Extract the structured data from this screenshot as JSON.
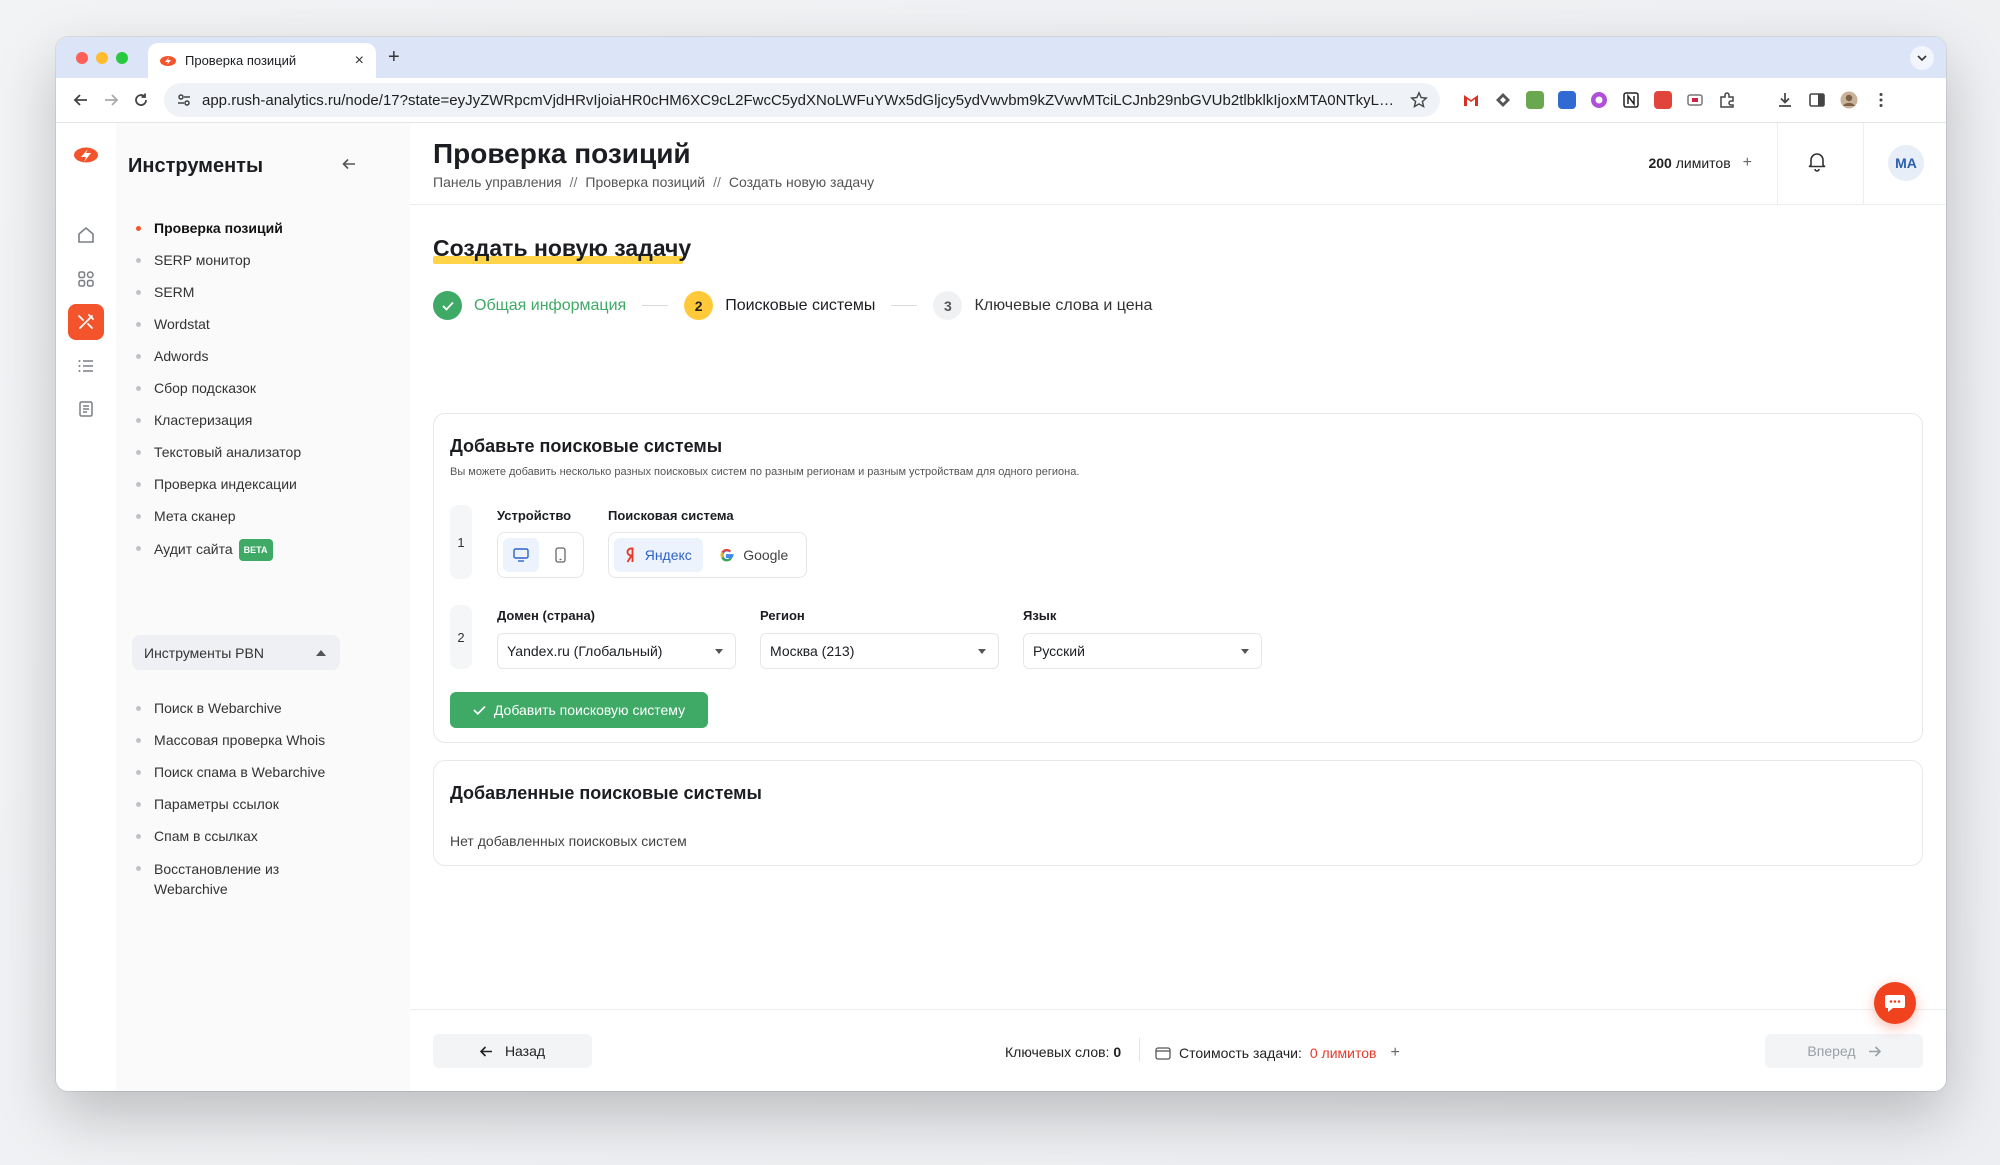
{
  "browser": {
    "tab_title": "Проверка позиций",
    "new_tab": "+",
    "tab_close": "×",
    "url": "app.rush-analytics.ru/node/17?state=eyJyZWRpcmVjdHRvIjoiaHR0cHM6XC9cL2FwcC5ydXNoLWFuYWx5dGljcy5ydVwvbm9kZVwvMTciLCJnb29nbGVUb2tlbklkIjoxMTA0NTkyLCJ5Y...",
    "icons": [
      "back-arrow-icon",
      "forward-arrow-icon",
      "reload-icon",
      "site-settings-icon",
      "star-icon"
    ]
  },
  "sidebar": {
    "title": "Инструменты",
    "tools": [
      {
        "label": "Проверка позиций",
        "active": true
      },
      {
        "label": "SERP монитор"
      },
      {
        "label": "SERM"
      },
      {
        "label": "Wordstat"
      },
      {
        "label": "Adwords"
      },
      {
        "label": "Сбор подсказок"
      },
      {
        "label": "Кластеризация"
      },
      {
        "label": "Текстовый анализатор"
      },
      {
        "label": "Проверка индексации"
      },
      {
        "label": "Мета сканер"
      },
      {
        "label": "Аудит сайта",
        "badge": "BETA"
      }
    ],
    "pbn_toggle": "Инструменты PBN",
    "pbn_tools": [
      {
        "label": "Поиск в Webarchive"
      },
      {
        "label": "Массовая проверка Whois"
      },
      {
        "label": "Поиск спама в Webarchive"
      },
      {
        "label": "Параметры ссылок"
      },
      {
        "label": "Спам в ссылках"
      },
      {
        "label": "Восстановление из Webarchive"
      }
    ]
  },
  "header": {
    "title": "Проверка позиций",
    "breadcrumb": [
      "Панель управления",
      "Проверка позиций",
      "Создать новую задачу"
    ],
    "breadcrumb_sep": "//",
    "limits_value": "200",
    "limits_label": "лимитов",
    "limits_plus": "+",
    "avatar": "MA"
  },
  "page": {
    "section_title": "Создать новую задачу",
    "steps": [
      {
        "num": "",
        "label": "Общая информация",
        "state": "done"
      },
      {
        "num": "2",
        "label": "Поисковые системы",
        "state": "current"
      },
      {
        "num": "3",
        "label": "Ключевые слова и цена",
        "state": "next"
      }
    ]
  },
  "add_card": {
    "title": "Добавьте поисковые системы",
    "subtitle": "Вы можете добавить несколько разных поисковых систем по разным регионам и разным устройствам для одного региона.",
    "row1_num": "1",
    "row2_num": "2",
    "device_label": "Устройство",
    "engine_label": "Поисковая система",
    "engines": [
      {
        "label": "Яндекс",
        "selected": true
      },
      {
        "label": "Google",
        "selected": false
      }
    ],
    "domain_label": "Домен (страна)",
    "domain_value": "Yandex.ru (Глобальный)",
    "region_label": "Регион",
    "region_value": "Москва (213)",
    "language_label": "Язык",
    "language_value": "Русский",
    "add_button": "Добавить поисковую систему"
  },
  "added_card": {
    "title": "Добавленные поисковые системы",
    "empty_text": "Нет добавленных поисковых систем"
  },
  "footer": {
    "back": "Назад",
    "keywords_label": "Ключевых слов:",
    "keywords_value": "0",
    "cost_label": "Стоимость задачи:",
    "cost_value": "0 лимитов",
    "cost_plus": "+",
    "forward": "Вперед"
  },
  "colors": {
    "brand_orange": "#f3542b",
    "success_green": "#3eaa66",
    "step_yellow": "#ffc93a",
    "highlight_yellow": "#ffd23f",
    "cost_red": "#e53a2b"
  }
}
